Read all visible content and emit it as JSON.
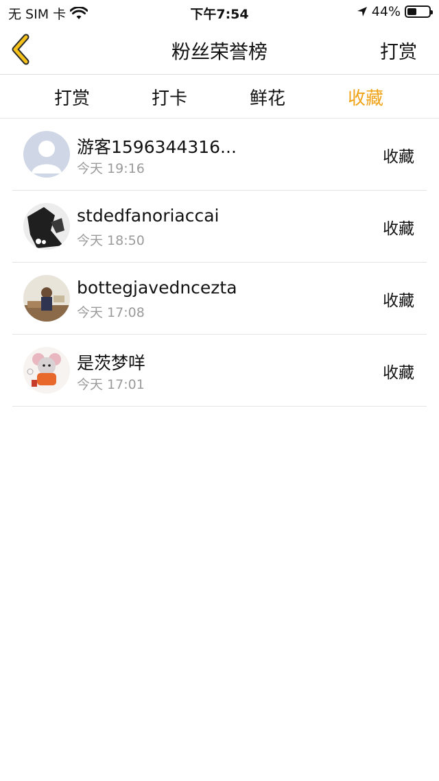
{
  "status_bar": {
    "carrier": "无 SIM 卡",
    "time": "下午7:54",
    "battery": "44%",
    "battery_level": 0.44
  },
  "nav": {
    "title": "粉丝荣誉榜",
    "action": "打赏"
  },
  "tabs": [
    {
      "label": "打赏",
      "active": false
    },
    {
      "label": "打卡",
      "active": false
    },
    {
      "label": "鲜花",
      "active": false
    },
    {
      "label": "收藏",
      "active": true
    }
  ],
  "accent_color": "#f0a317",
  "list": [
    {
      "name": "游客1596344316...",
      "time": "今天 19:16",
      "action": "收藏",
      "avatar": "default-person-avatar"
    },
    {
      "name": "stdedfanoriaccai",
      "time": "今天 18:50",
      "action": "收藏",
      "avatar": "monochrome-photo-avatar"
    },
    {
      "name": "bottegjavedncezta",
      "time": "今天 17:08",
      "action": "收藏",
      "avatar": "room-photo-avatar"
    },
    {
      "name": "是茨梦咩",
      "time": "今天 17:01",
      "action": "收藏",
      "avatar": "cartoon-mouse-avatar"
    }
  ]
}
